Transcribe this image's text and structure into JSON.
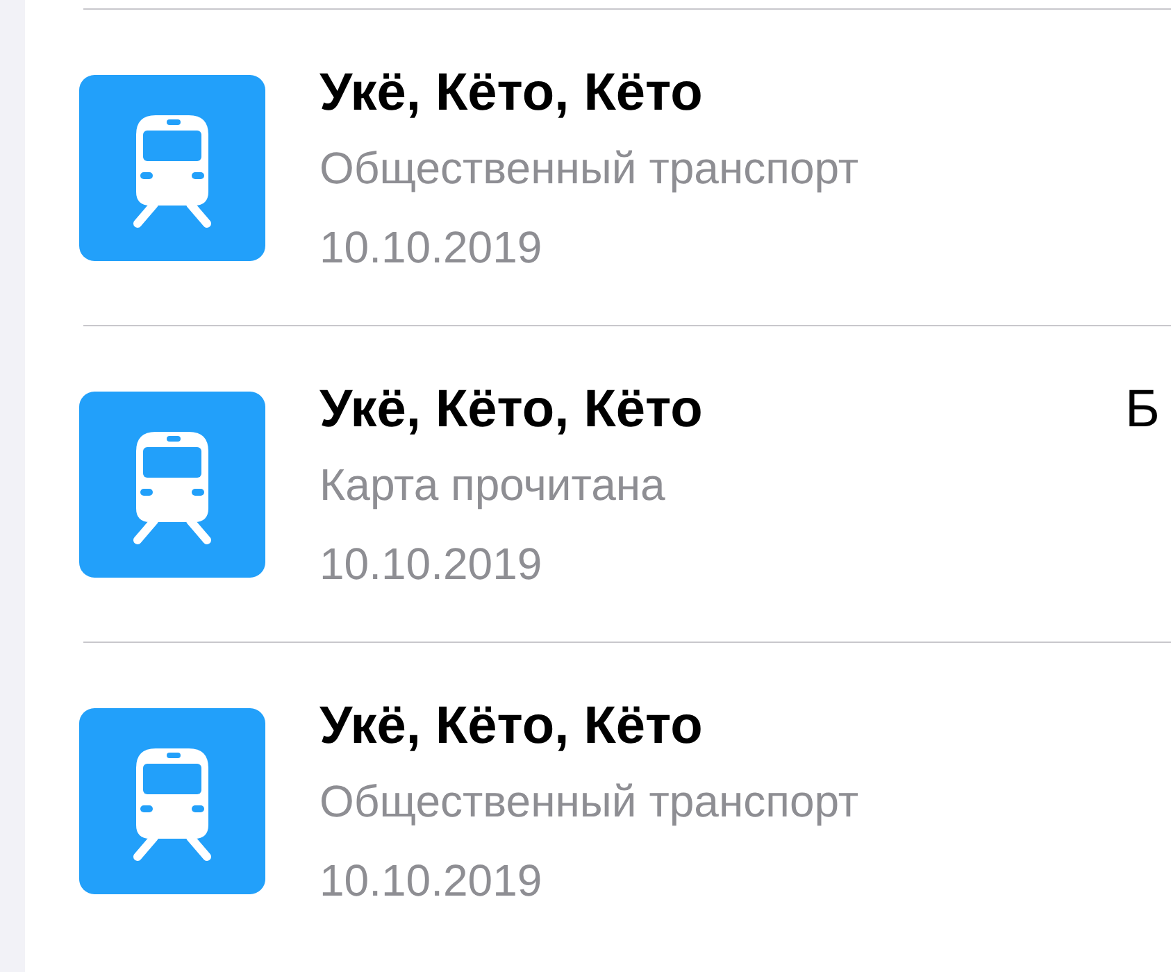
{
  "transactions": [
    {
      "title": "Укё, Кёто, Кёто",
      "subtitle": "Общественный транспорт",
      "date": "10.10.2019"
    },
    {
      "title": "Укё, Кёто, Кёто",
      "subtitle": "Карта прочитана",
      "date": "10.10.2019",
      "amount": "Б"
    },
    {
      "title": "Укё, Кёто, Кёто",
      "subtitle": "Общественный транспорт",
      "date": "10.10.2019"
    }
  ]
}
